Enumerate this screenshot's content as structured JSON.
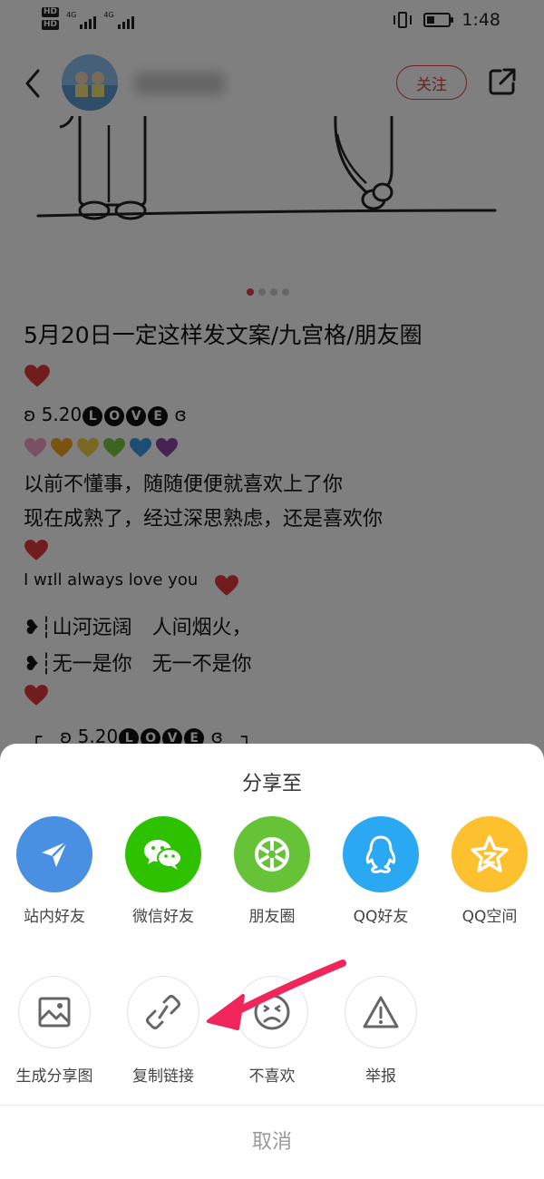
{
  "status_bar": {
    "badges": [
      "HD",
      "HD"
    ],
    "network_labels": [
      "4G",
      "4G"
    ],
    "time": "1:48"
  },
  "header": {
    "follow_label": "关注"
  },
  "post": {
    "title": "5月20日一定这样发文案/九宫格/朋友圈",
    "date_tag_prefix": "ʚ 5.20",
    "love_letters": [
      "L",
      "O",
      "V",
      "E"
    ],
    "date_tag_suffix": "ɞ",
    "line1": "以前不懂事，随随便便就喜欢上了你",
    "line2": "现在成熟了，经过深思熟虑，还是喜欢你",
    "line3": "I wɪll always love you",
    "line4": "❥┆山河远阔　人间烟火，",
    "line5": "❥┆无一是你　无一不是你",
    "line6_prefix": "┌　ʚ 5.20",
    "line6_suffix": "ɞ　┐",
    "emoji_hearts": [
      "#f5a0c8",
      "#f5a623",
      "#f7d046",
      "#7ac943",
      "#3b9ae8",
      "#8e44ad"
    ],
    "heart_color": "#e23b3b"
  },
  "share_sheet": {
    "title": "分享至",
    "apps": [
      {
        "label": "站内好友",
        "color": "#4a90e2",
        "icon": "paper-plane-icon"
      },
      {
        "label": "微信好友",
        "color": "#2dc100",
        "icon": "wechat-icon"
      },
      {
        "label": "朋友圈",
        "color": "#66c236",
        "icon": "moments-icon"
      },
      {
        "label": "QQ好友",
        "color": "#2aa8f2",
        "icon": "qq-penguin-icon"
      },
      {
        "label": "QQ空间",
        "color": "#fdc02f",
        "icon": "qzone-star-icon"
      }
    ],
    "actions": [
      {
        "label": "生成分享图",
        "icon": "image-icon"
      },
      {
        "label": "复制链接",
        "icon": "link-icon"
      },
      {
        "label": "不喜欢",
        "icon": "dislike-face-icon"
      },
      {
        "label": "举报",
        "icon": "warning-icon"
      }
    ],
    "cancel_label": "取消"
  },
  "annotation": {
    "arrow_color": "#f0265a"
  }
}
